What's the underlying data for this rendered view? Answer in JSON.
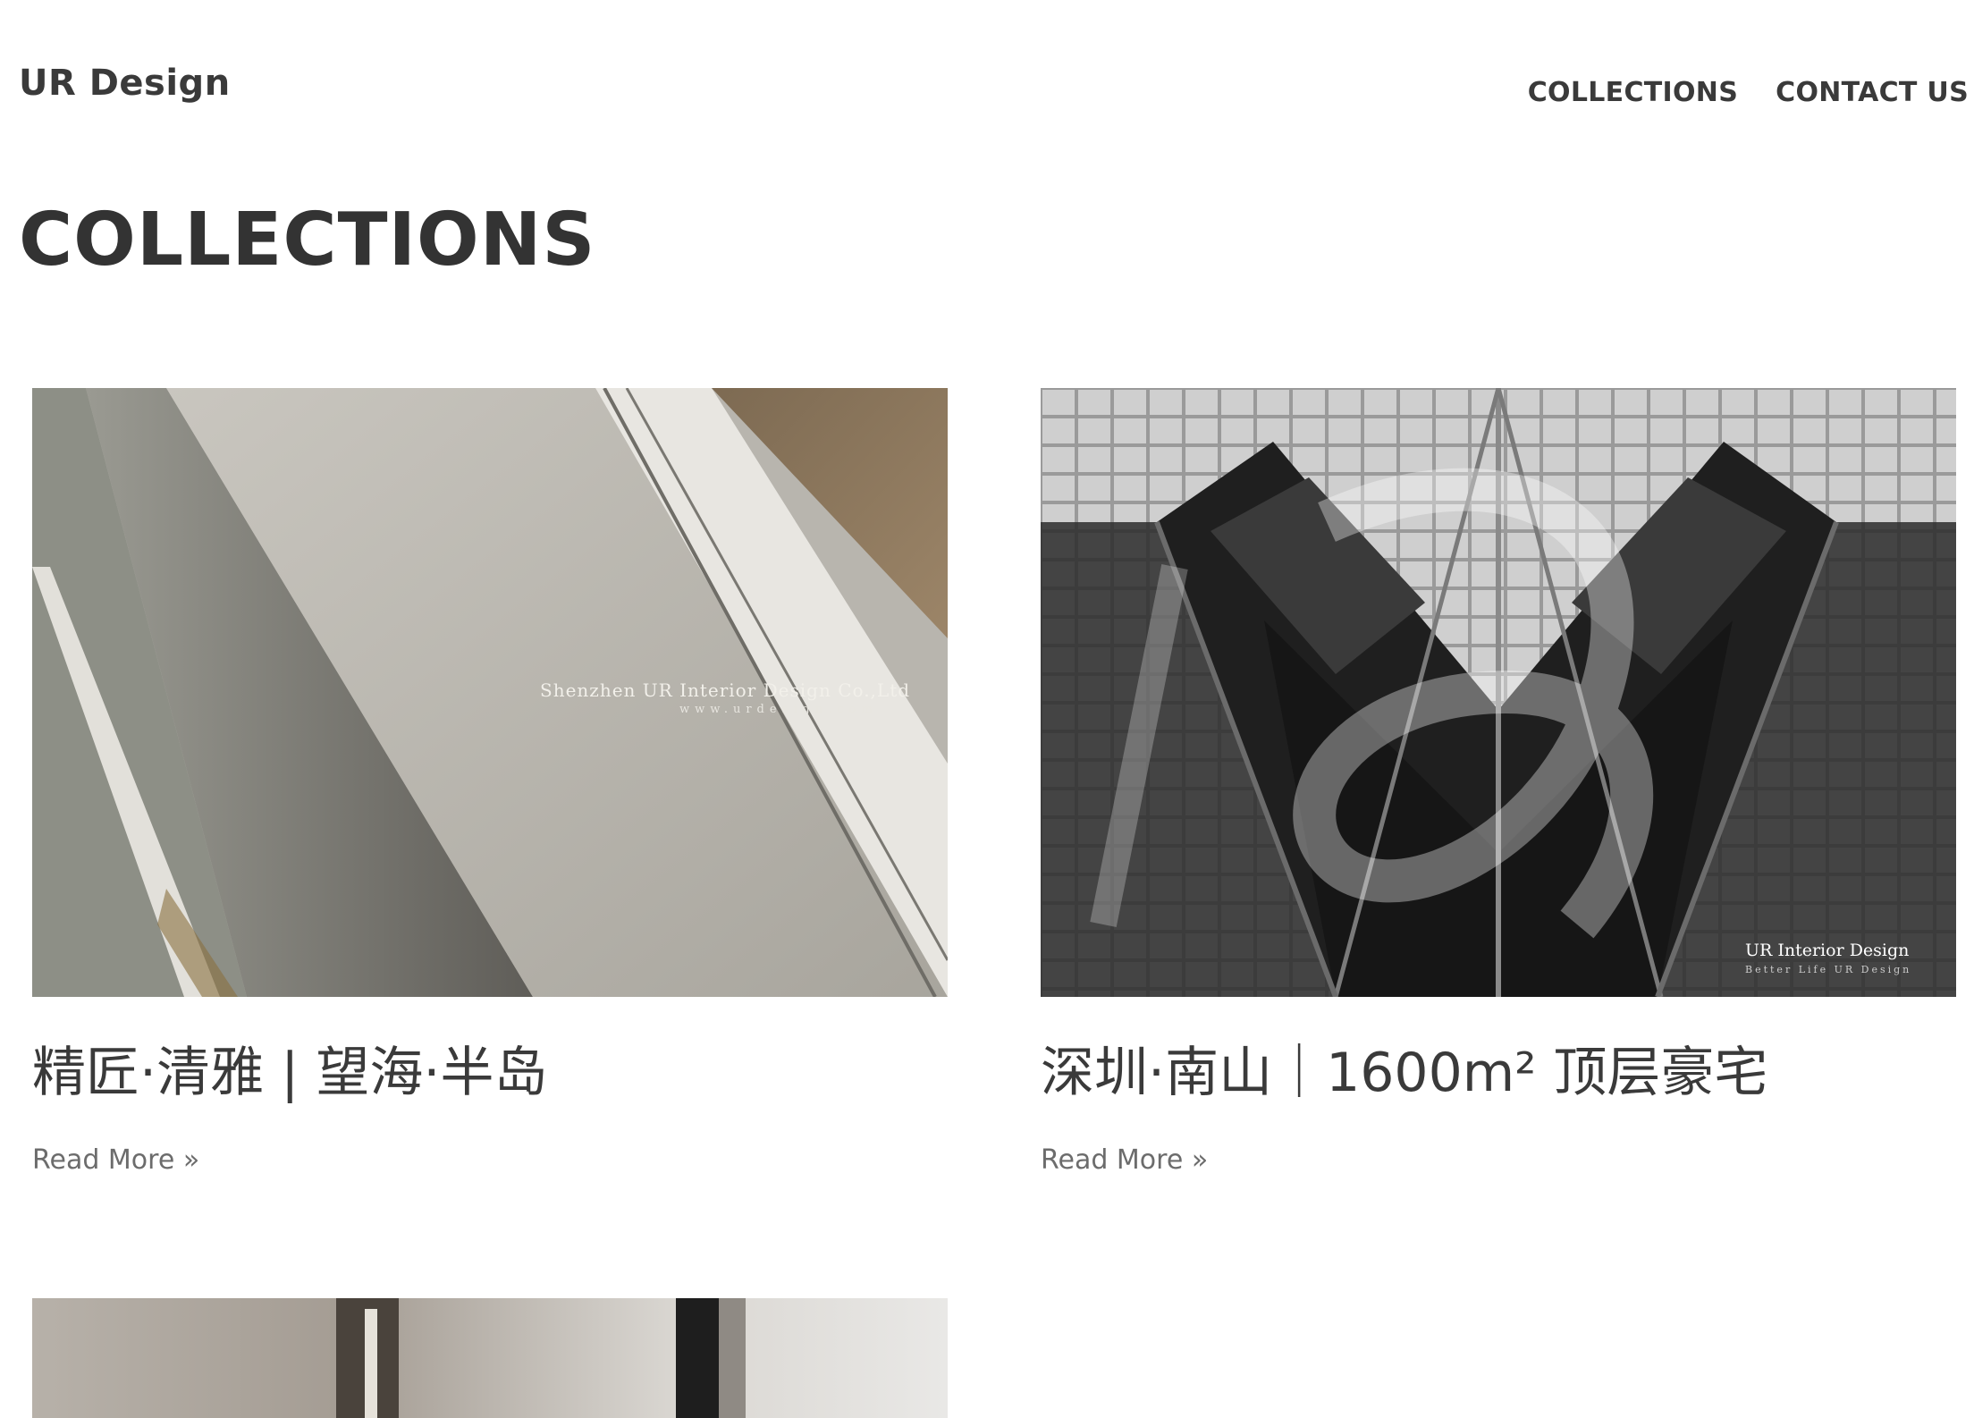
{
  "header": {
    "site_title": "UR Design",
    "nav": [
      {
        "label": "COLLECTIONS"
      },
      {
        "label": "CONTACT US"
      }
    ]
  },
  "main": {
    "heading": "COLLECTIONS",
    "posts": [
      {
        "title": "精匠·清雅 | 望海·半岛",
        "read_more": "Read More »",
        "image_watermark": {
          "line1": "Shenzhen UR Interior Design Co.,Ltd",
          "line2": "www.urdesign.com"
        }
      },
      {
        "title": "深圳·南山｜1600m² 顶层豪宅",
        "read_more": "Read More »",
        "image_watermark": {
          "line1": "UR Interior Design",
          "line2": "Better Life UR Design"
        }
      },
      {
        "title": "",
        "read_more": ""
      }
    ]
  },
  "colors": {
    "text_primary": "#3a3a3a",
    "text_muted": "#6c6c6c",
    "background": "#ffffff"
  }
}
